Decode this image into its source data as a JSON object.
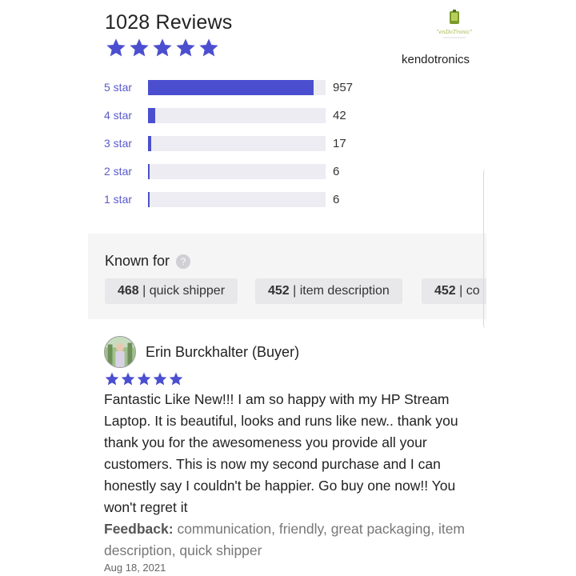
{
  "header": {
    "title": "1028 Reviews",
    "rating_stars": 5,
    "shop_name": "kendotronics",
    "logo_text": "KenDoTronic"
  },
  "distribution": [
    {
      "label": "5 star",
      "count": "957",
      "fraction": 0.931
    },
    {
      "label": "4 star",
      "count": "42",
      "fraction": 0.041
    },
    {
      "label": "3 star",
      "count": "17",
      "fraction": 0.017
    },
    {
      "label": "2 star",
      "count": "6",
      "fraction": 0.006
    },
    {
      "label": "1 star",
      "count": "6",
      "fraction": 0.006
    }
  ],
  "known_for": {
    "title": "Known for",
    "chips": [
      {
        "count": "468",
        "label": "quick shipper"
      },
      {
        "count": "452",
        "label": "item description"
      },
      {
        "count": "452",
        "label": "co"
      }
    ]
  },
  "review": {
    "reviewer": "Erin Burckhalter (Buyer)",
    "stars": 5,
    "body": "Fantastic Like New!!! I am so happy with my HP Stream Laptop. It is beautiful,  looks and runs like new.. thank you thank you for the awesomeness you provide all your customers.  This is now my second purchase and I can honestly say I couldn't be happier.  Go buy one now!! You won't regret it",
    "feedback_label": "Feedback:",
    "feedback_text": "communication, friendly, great packaging, item description, quick shipper",
    "date": "Aug 18, 2021"
  },
  "colors": {
    "star": "#4b4fcf",
    "bar_fill": "#4b4fcf",
    "bar_track": "#ececf2",
    "star_label": "#5a5acb"
  },
  "icons": {
    "star": "star-icon",
    "help": "question-circle-icon"
  }
}
